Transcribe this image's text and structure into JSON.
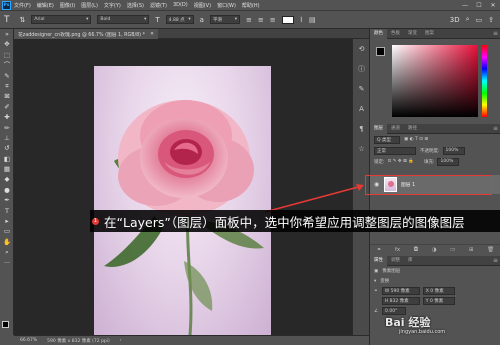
{
  "app": {
    "logo": "Ps"
  },
  "menu": [
    "文件(F)",
    "编辑(E)",
    "图像(I)",
    "图层(L)",
    "文字(Y)",
    "选择(S)",
    "滤镜(T)",
    "3D(D)",
    "视图(V)",
    "窗口(W)",
    "帮助(H)"
  ],
  "window_buttons": [
    "—",
    "☐",
    "✕"
  ],
  "options": {
    "font_family": "Arial",
    "font_style": "Bold",
    "font_size": "4.88 点",
    "antialias": "平滑"
  },
  "document": {
    "tab_title": "花zaddesigner_cn玫瑰.png @ 66.7% (图层 1, RGB/8) *",
    "zoom": "66.67%",
    "size": "590 像素 x 832 像素 (72 ppi)"
  },
  "color_panel": {
    "tabs": [
      "颜色",
      "色板",
      "渐变",
      "图案"
    ]
  },
  "layers_panel": {
    "tabs": [
      "图层",
      "通道",
      "路径"
    ],
    "filter_label": "Q 类型",
    "blend_mode": "正常",
    "opacity_label": "不透明度:",
    "opacity": "100%",
    "lock_label": "锁定:",
    "fill_label": "填充:",
    "fill": "100%",
    "layer_name": "图层 1"
  },
  "props_panel": {
    "tabs": [
      "属性",
      "调整",
      "库"
    ],
    "kind": "像素图层",
    "transform_label": "变换",
    "w": "W 590 像素",
    "x": "X 0 像素",
    "h": "H 832 像素",
    "y": "Y 0 像素",
    "angle": "0.00°"
  },
  "annotation": {
    "marker": "1",
    "text": "在“Layers”（图层）面板中，选中你希望应用调整图层的图像图层",
    "accent_color": "#e53935"
  },
  "watermark": {
    "main": "Bai 经验",
    "sub": "jingyan.baidu.com"
  }
}
